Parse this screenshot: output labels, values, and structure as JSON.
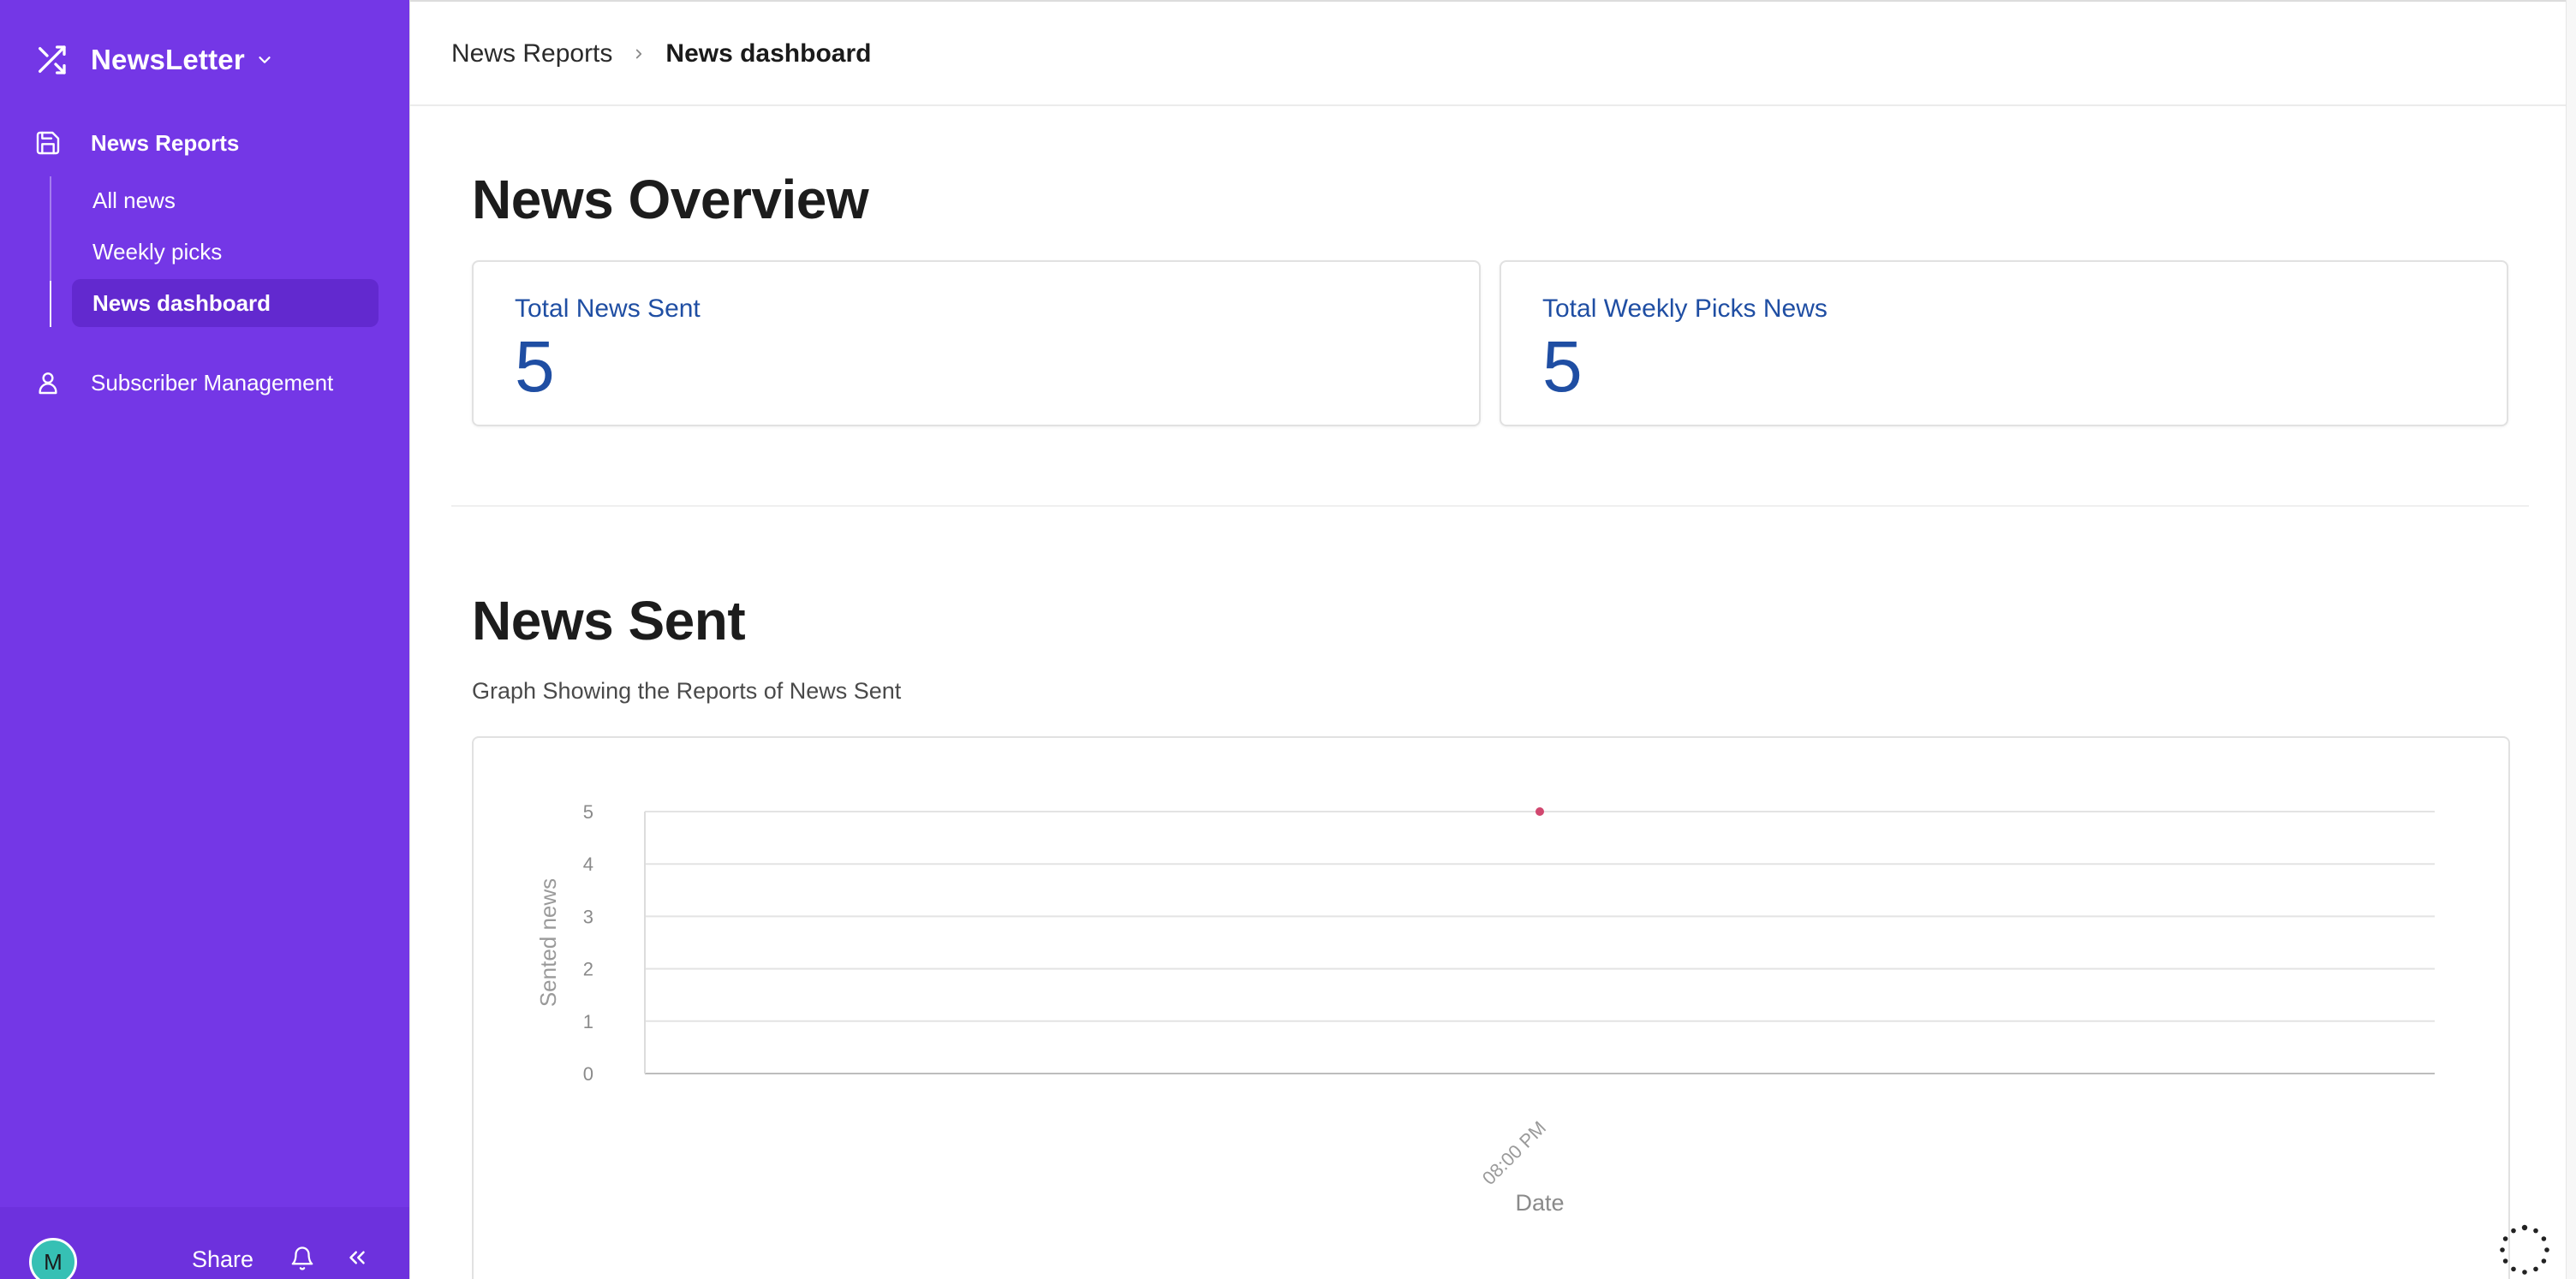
{
  "app": {
    "name": "NewsLetter"
  },
  "sidebar": {
    "section": {
      "label": "News Reports",
      "icon": "save-icon"
    },
    "items": [
      {
        "label": "All news",
        "active": false
      },
      {
        "label": "Weekly picks",
        "active": false
      },
      {
        "label": "News dashboard",
        "active": true
      }
    ],
    "second_section": {
      "label": "Subscriber Management",
      "icon": "user-icon"
    },
    "footer": {
      "avatar_initial": "M",
      "share_label": "Share",
      "bell_icon": "bell-icon",
      "collapse_icon": "double-chevron-left-icon"
    }
  },
  "breadcrumb": {
    "parent": "News Reports",
    "current": "News dashboard"
  },
  "overview": {
    "title": "News Overview",
    "cards": [
      {
        "label": "Total News Sent",
        "value": "5"
      },
      {
        "label": "Total Weekly Picks News",
        "value": "5"
      }
    ]
  },
  "news_sent": {
    "title": "News Sent",
    "subtitle": "Graph Showing the Reports of News Sent"
  },
  "colors": {
    "sidebar": "#7437e6",
    "sidebar_active": "#6229cf",
    "stat_text": "#1f4ea3",
    "point": "#d1476f",
    "avatar": "#36c0b4"
  },
  "chart_data": {
    "type": "scatter",
    "xlabel": "Date",
    "ylabel": "Sented news",
    "x": [
      "08:00 PM"
    ],
    "y": [
      5
    ],
    "yticks": [
      0,
      1,
      2,
      3,
      4,
      5
    ],
    "ylim": [
      0,
      5
    ],
    "grid": true,
    "legend": "none"
  }
}
